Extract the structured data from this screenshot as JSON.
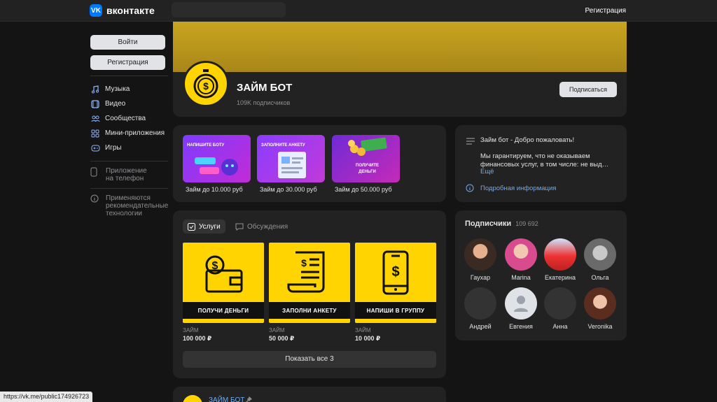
{
  "topbar": {
    "logo_mark": "VK",
    "logo_text": "вконтакте",
    "register": "Регистрация"
  },
  "sidebar": {
    "login": "Войти",
    "register": "Регистрация",
    "items": [
      {
        "label": "Музыка",
        "icon": "music-note-icon"
      },
      {
        "label": "Видео",
        "icon": "video-icon"
      },
      {
        "label": "Сообщества",
        "icon": "users-icon"
      },
      {
        "label": "Мини-приложения",
        "icon": "apps-icon"
      },
      {
        "label": "Игры",
        "icon": "gamepad-icon"
      }
    ],
    "phone_app": "Приложение на телефон",
    "tech_info": "Применяются рекомендательные технологии"
  },
  "group": {
    "name": "ЗАЙМ БОТ",
    "subscribers": "109K подписчиков",
    "subscribe": "Подписаться"
  },
  "promos": [
    {
      "title": "НАПИШИТЕ БОТУ",
      "label": "Займ до 10.000 руб"
    },
    {
      "title": "ЗАПОЛНИТЕ АНКЕТУ",
      "label": "Займ до 30.000 руб"
    },
    {
      "title": "ПОЛУЧИТЕ ДЕНЬГИ",
      "label": "Займ до 50.000 руб"
    }
  ],
  "welcome": {
    "title": "Займ бот - Добро пожаловать!",
    "text": "Мы гарантируем, что не оказываем финансовых услуг, в том числе: не выд…",
    "more": "Ещё",
    "details": "Подробная информация"
  },
  "tabs": {
    "services": "Услуги",
    "discussions": "Обсуждения"
  },
  "services": [
    {
      "band": "ПОЛУЧИ ДЕНЬГИ",
      "caption": "ЗАЙМ",
      "amount": "100 000 ₽"
    },
    {
      "band": "ЗАПОЛНИ АНКЕТУ",
      "caption": "ЗАЙМ",
      "amount": "50 000 ₽"
    },
    {
      "band": "НАПИШИ В ГРУППУ",
      "caption": "ЗАЙМ",
      "amount": "10 000 ₽"
    }
  ],
  "show_all": "Показать все 3",
  "subscribers": {
    "title": "Подписчики",
    "count": "109 692",
    "members": [
      {
        "name": "Гаухар"
      },
      {
        "name": "Marina"
      },
      {
        "name": "Екатерина"
      },
      {
        "name": "Ольга"
      },
      {
        "name": "Андрей"
      },
      {
        "name": "Евгения"
      },
      {
        "name": "Анна"
      },
      {
        "name": "Veronika"
      }
    ]
  },
  "post": {
    "author": "ЗАЙМ БОТ"
  },
  "status_url": "https://vk.me/public174926723",
  "colors": {
    "accent": "#0077ff",
    "brand_yellow": "#ffd400",
    "link": "#71aaeb"
  }
}
